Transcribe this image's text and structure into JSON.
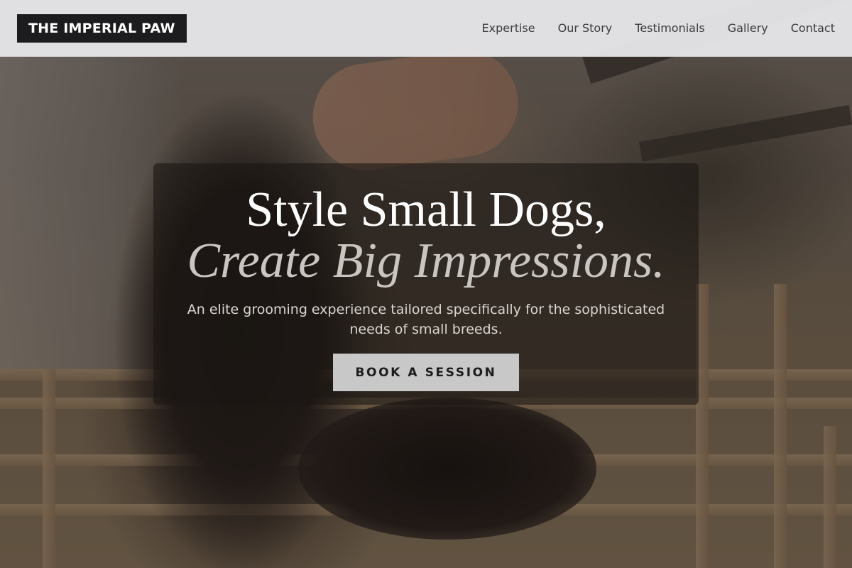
{
  "header": {
    "brand": "THE IMPERIAL PAW",
    "nav": [
      {
        "label": "Expertise"
      },
      {
        "label": "Our Story"
      },
      {
        "label": "Testimonials"
      },
      {
        "label": "Gallery"
      },
      {
        "label": "Contact"
      }
    ]
  },
  "hero": {
    "headline_line1": "Style Small Dogs,",
    "headline_line2": "Create Big Impressions.",
    "subtitle": "An elite grooming experience tailored specifically for the sophisticated needs of small breeds.",
    "cta_label": "BOOK A SESSION"
  },
  "colors": {
    "header_bg": "#ebebed",
    "brand_bg": "#1c1c1e",
    "cta_bg": "#c9c8c8",
    "headline_italic": "#c9c6c2"
  }
}
